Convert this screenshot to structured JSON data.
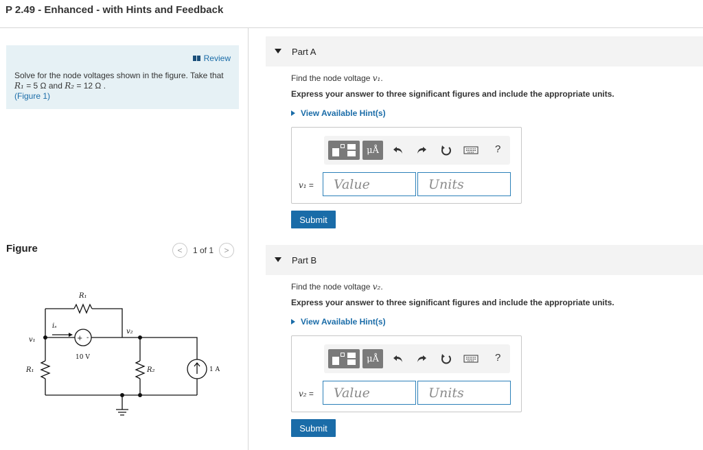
{
  "page": {
    "title": "P 2.49 - Enhanced - with Hints and Feedback"
  },
  "intro": {
    "review_label": "Review",
    "text_1": "Solve for the node voltages shown in the figure. Take that",
    "r1_symbol": "R₁",
    "r1_value": " = 5 Ω and ",
    "r2_symbol": "R₂",
    "r2_value": " = 12 Ω .",
    "figure_link": "(Figure 1)"
  },
  "figure": {
    "label": "Figure",
    "pager_text": "1 of 1",
    "prev_glyph": "<",
    "next_glyph": ">",
    "circuit_labels": {
      "r1_top": "R₁",
      "r1_left": "R₁",
      "r2": "R₂",
      "v1": "v₁",
      "v2": "v₂",
      "is": "iₛ",
      "source_v": "10 V",
      "source_i": "1 A",
      "plus": "+",
      "minus": "-"
    }
  },
  "parts": [
    {
      "title": "Part A",
      "find_text": "Find the node voltage ",
      "find_var": "v₁",
      "find_end": ".",
      "express": "Express your answer to three significant figures and include the appropriate units.",
      "hint": "View Available Hint(s)",
      "var_label": "v₁",
      "equals": " =",
      "value_placeholder": "Value",
      "units_placeholder": "Units",
      "mu_label": "μÅ",
      "help_label": "?",
      "submit": "Submit"
    },
    {
      "title": "Part B",
      "find_text": "Find the node voltage ",
      "find_var": "v₂",
      "find_end": ".",
      "express": "Express your answer to three significant figures and include the appropriate units.",
      "hint": "View Available Hint(s)",
      "var_label": "v₂",
      "equals": " =",
      "value_placeholder": "Value",
      "units_placeholder": "Units",
      "mu_label": "μÅ",
      "help_label": "?",
      "submit": "Submit"
    }
  ],
  "colors": {
    "link": "#1a6ca8",
    "button": "#1a6ca8",
    "intro_bg": "#e6f1f5",
    "part_header_bg": "#f3f3f3"
  },
  "icons": [
    "review-icon",
    "template-icon",
    "undo-icon",
    "redo-icon",
    "reset-icon",
    "keyboard-icon",
    "help-icon",
    "collapse-triangle-icon",
    "hint-triangle-icon"
  ]
}
